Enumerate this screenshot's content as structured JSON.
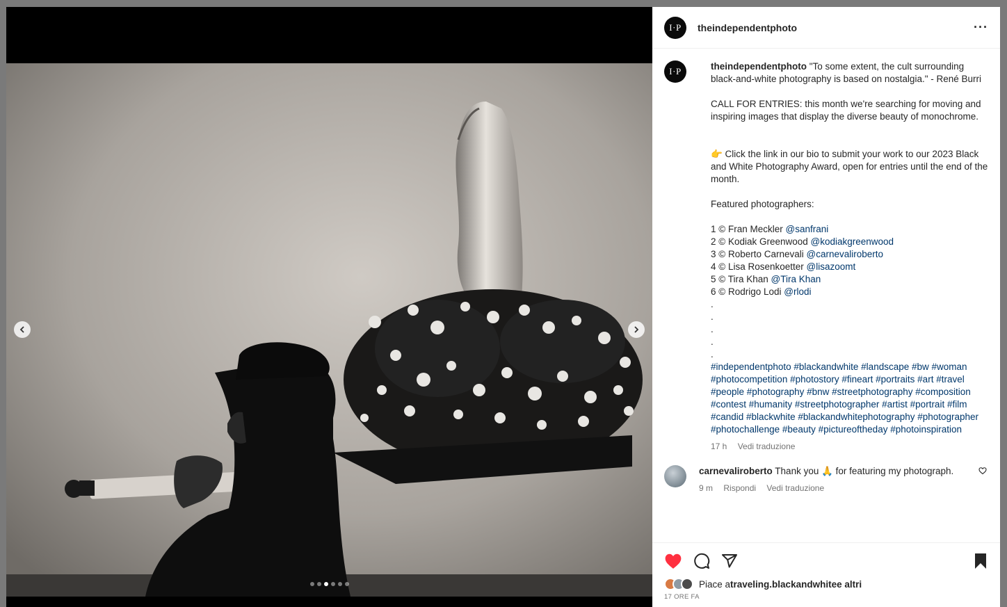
{
  "post": {
    "username": "theindependentphoto",
    "avatar_text": "I·P",
    "more_icon": "more-options-icon"
  },
  "media": {
    "carousel_count": 6,
    "carousel_active": 3,
    "description_icon": "photo"
  },
  "caption": {
    "username": "theindependentphoto",
    "quote": " \"To some extent, the cult surrounding black-and-white photography is based on nostalgia.\" - René Burri",
    "call": "CALL FOR ENTRIES: this month we're searching for moving and inspiring images that display the diverse beauty of monochrome.",
    "cta": "👉 Click the link in our bio to submit your work to our 2023 Black and White Photography Award, open for entries until the end of the month.",
    "featured_heading": "Featured photographers:",
    "photographers": [
      {
        "prefix": "1 © Fran Meckler ",
        "handle": "@sanfrani"
      },
      {
        "prefix": "2 © Kodiak Greenwood ",
        "handle": "@kodiakgreenwood"
      },
      {
        "prefix": "3 © Roberto Carnevali ",
        "handle": "@carnevaliroberto"
      },
      {
        "prefix": "4 © Lisa Rosenkoetter ",
        "handle": "@lisazoomt"
      },
      {
        "prefix": "5 © Tira Khan ",
        "handle": "@Tira Khan"
      },
      {
        "prefix": "6 © Rodrigo Lodi ",
        "handle": "@rlodi"
      }
    ],
    "dots": ".\n.\n.\n.\n.",
    "hashtags": "#independentphoto #blackandwhite #landscape #bw #woman #photocompetition #photostory #fineart #portraits #art #travel #people #photography #bnw #streetphotography #composition #contest #humanity #streetphotographer #artist #portrait #film #candid #blackwhite #blackandwhitephotography #photographer #photochallenge #beauty #pictureoftheday #photoinspiration",
    "time": "17 h",
    "translate": "Vedi traduzione"
  },
  "comment": {
    "username": "carnevaliroberto",
    "text": " Thank you 🙏 for featuring my photograph.",
    "time": "9 m",
    "reply": "Rispondi",
    "translate": "Vedi traduzione"
  },
  "actions": {
    "liked": true,
    "like_color": "#ff3040",
    "likes_prefix": "Piace a ",
    "likes_user": "traveling.blackandwhite",
    "likes_suffix": " e altri",
    "timestamp": "17 ORE FA"
  }
}
